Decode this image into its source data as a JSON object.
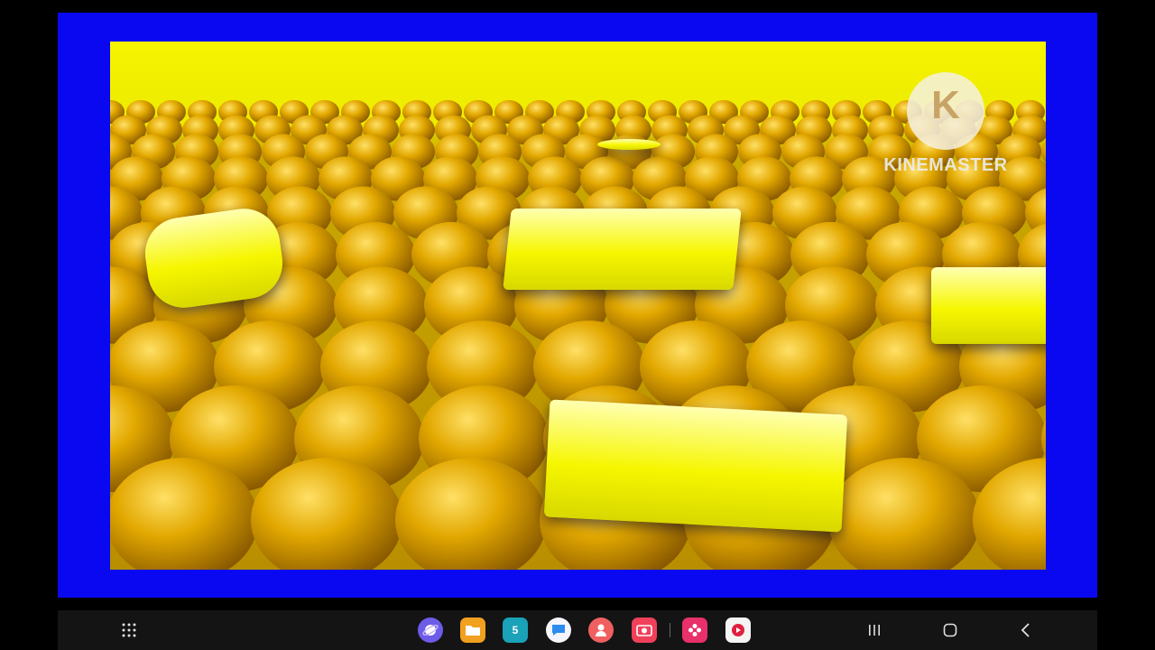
{
  "watermark": {
    "logo_letter": "K",
    "brand": "KINEMASTER"
  },
  "video": {
    "background_color": "#0a08f0",
    "floor_color": "#c9a000",
    "sky_color": "#f4f200"
  },
  "calendar_icon": {
    "day": "5"
  },
  "dock": {
    "apps": [
      {
        "name": "internet-app-icon",
        "color": "#6c5ce7"
      },
      {
        "name": "my-files-app-icon",
        "color": "#f2a020"
      },
      {
        "name": "calendar-app-icon",
        "color": "#19a2b8"
      },
      {
        "name": "messages-app-icon",
        "color": "#2d8cf0"
      },
      {
        "name": "contacts-app-icon",
        "color": "#f06060"
      },
      {
        "name": "camera-app-icon",
        "color": "#f0405a"
      },
      {
        "name": "gallery-app-icon",
        "color": "#e8306a"
      },
      {
        "name": "screen-recorder-app-icon",
        "color": "#e02040"
      }
    ]
  }
}
